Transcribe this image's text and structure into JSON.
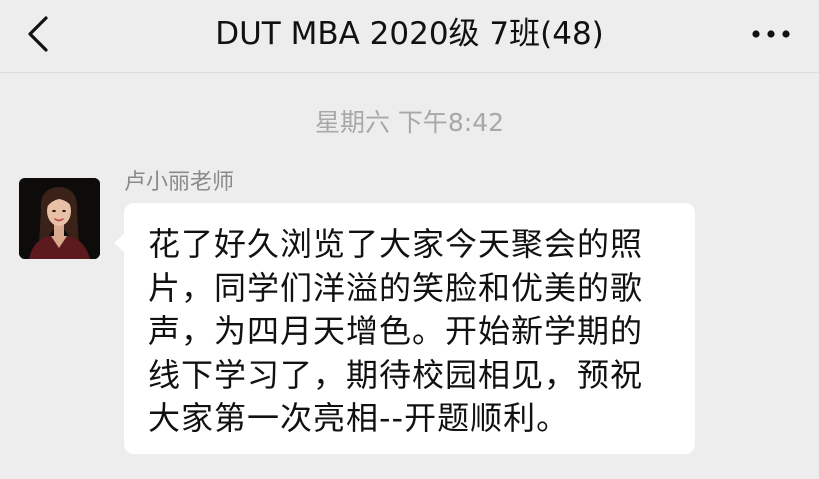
{
  "header": {
    "title": "DUT MBA 2020级 7班(48)",
    "back_icon": "chevron-left-icon",
    "more_icon": "more-dots-icon"
  },
  "chat": {
    "timestamp": "星期六 下午8:42",
    "messages": [
      {
        "sender": "卢小丽老师",
        "avatar": "woman-portrait-avatar",
        "text": "花了好久浏览了大家今天聚会的照片，同学们洋溢的笑脸和优美的歌声，为四月天增色。开始新学期的线下学习了，期待校园相见，预祝大家第一次亮相--开题顺利。"
      }
    ]
  },
  "colors": {
    "background": "#ededed",
    "bubble": "#ffffff",
    "text": "#111111",
    "muted": "#a8a8a8"
  }
}
